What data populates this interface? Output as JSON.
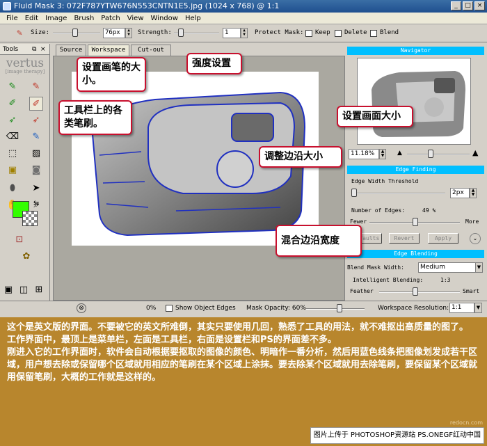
{
  "window": {
    "title": "Fluid Mask 3: 072F787YTW676N553CNTN1E5.jpg (1024 x 768) @ 1:1"
  },
  "menu": [
    "File",
    "Edit",
    "Image",
    "Brush",
    "Patch",
    "View",
    "Window",
    "Help"
  ],
  "toolbar": {
    "size_label": "Size:",
    "size_value": "76px",
    "strength_label": "Strength:",
    "strength_value": "1",
    "protect_label": "Protect Mask:",
    "keep_label": "Keep",
    "delete_label": "Delete",
    "blend_label": "Blend"
  },
  "tools_panel": {
    "title": "Tools",
    "logo": "vertus",
    "logo_sub": "[image therapy]"
  },
  "tabs": [
    "Source",
    "Workspace",
    "Cut-out"
  ],
  "navigator": {
    "title": "Navigator",
    "zoom": "11.18%"
  },
  "edge_finding": {
    "title": "Edge Finding",
    "threshold_label": "Edge Width Threshold",
    "threshold_value": "2px",
    "edges_label": "Number of Edges:",
    "edges_value": "49 %",
    "fewer": "Fewer",
    "more": "More",
    "defaults_btn": "Defaults",
    "revert_btn": "Revert",
    "apply_btn": "Apply"
  },
  "edge_blending": {
    "title": "Edge Blending",
    "blend_width_label": "Blend Mask Width:",
    "blend_width_value": "Medium",
    "intelligent_label": "Intelligent Blending:",
    "ratio": "1:3",
    "feather": "Feather",
    "smart": "Smart"
  },
  "status": {
    "percent": "0%",
    "show_edges": "Show Object Edges",
    "opacity": "Mask Opacity: 60%",
    "resolution_label": "Workspace Resolution:",
    "resolution_value": "1:1"
  },
  "callouts": {
    "brush_size": "设置画笔的大小。",
    "strength": "强度设置",
    "toolbar_brushes": "工具栏上的各类笔刷。",
    "view_size": "设置画面大小",
    "edge_size": "调整边沿大小",
    "blend_width": "混合边沿宽度"
  },
  "description": [
    "这个是英文版的界面。不要被它的英文所难倒，其实只要使用几回，熟悉了工具的用法，就不难抠出高质量的图了。",
    "工作界面中，最顶上是菜单栏，左面是工具栏，右面是设置栏和PS的界面差不多。",
    "刚进入它的工作界面时，软件会自动根据要抠取的图像的颜色、明暗作一番分析，然后用蓝色线条把图像划发成若干区域，用户想去除或保留哪个区域就用相应的笔刷在某个区域上涂抹。要去除某个区域就用去除笔刷，要保留某个区域就用保留笔刷，大概的工作就是这样的。"
  ],
  "watermark": "redocn.com",
  "footer": "图片上传于 PHOTOSHOP资源站 PS.ONEGF红动中国",
  "colors": {
    "accent": "#00bfff",
    "callout_border": "#c8102e",
    "desc_bg": "#b8862d",
    "fg_swatch": "#33ff00"
  }
}
